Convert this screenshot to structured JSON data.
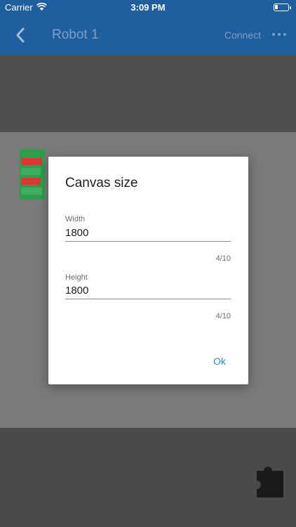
{
  "status_bar": {
    "carrier": "Carrier",
    "time": "3:09 PM"
  },
  "app_bar": {
    "title": "Robot 1",
    "connect_label": "Connect"
  },
  "dialog": {
    "title": "Canvas size",
    "width": {
      "label": "Width",
      "value": "1800",
      "counter": "4/10"
    },
    "height": {
      "label": "Height",
      "value": "1800",
      "counter": "4/10"
    },
    "ok_label": "Ok"
  },
  "icons": [
    "wifi-icon",
    "battery-icon",
    "back-arrow-icon",
    "more-icon",
    "puzzle-piece-icon"
  ],
  "colors": {
    "app_bar": "#1f5f9f",
    "accent": "#2e86c8",
    "block_green": "#2e9e4e",
    "block_red": "#d83a35"
  }
}
